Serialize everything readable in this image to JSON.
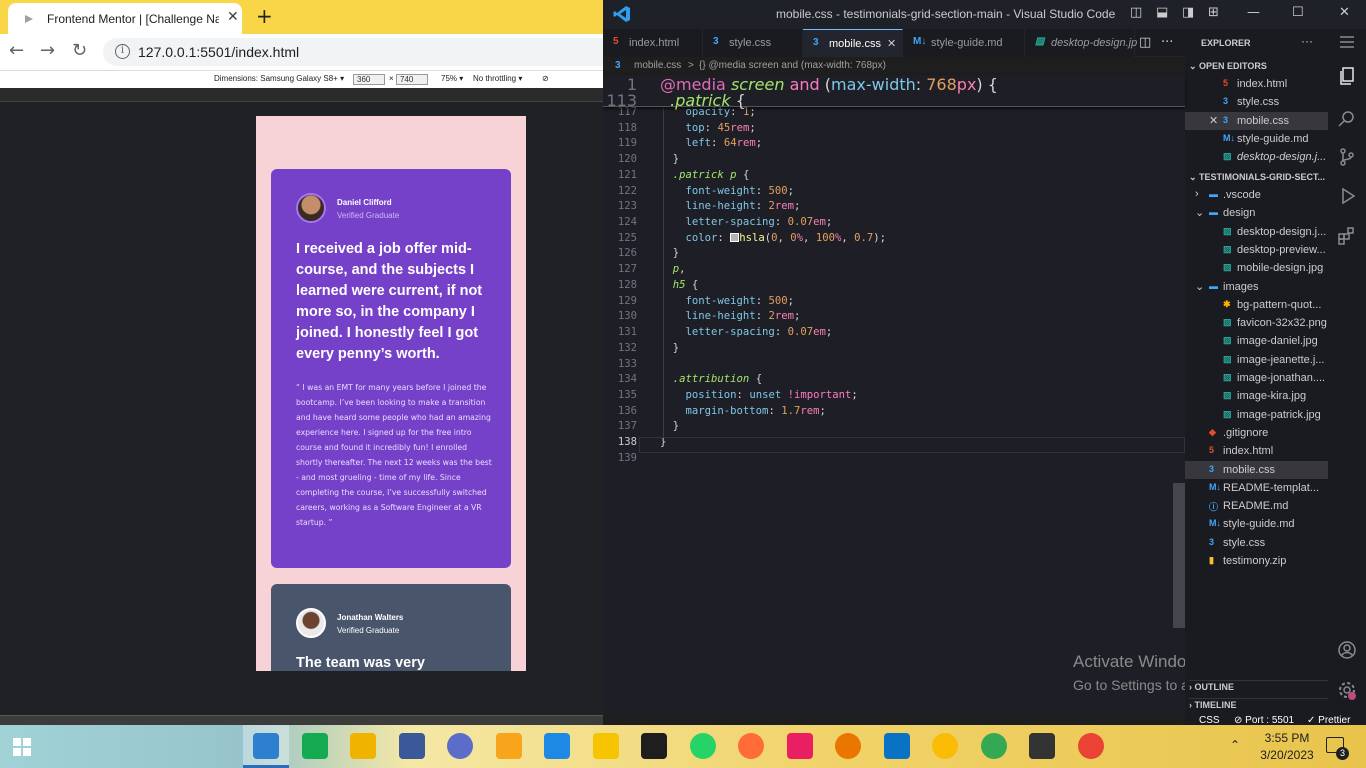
{
  "browser": {
    "tab_title": "Frontend Mentor | [Challenge Na",
    "url": "127.0.0.1:5501/index.html",
    "devtools": {
      "dimensions_label": "Dimensions: Samsung Galaxy S8+",
      "width": "360",
      "height": "740",
      "zoom": "75%",
      "throttling": "No throttling"
    }
  },
  "mobile_page": {
    "card1": {
      "name": "Daniel Clifford",
      "role": "Verified Graduate",
      "quote": "I received a job offer mid-course, and the subjects I learned were current, if not more so, in the company I joined. I honestly feel I got every penny’s worth.",
      "body": "“ I was an EMT for many years before I joined the bootcamp. I’ve been looking to make a transition and have heard some people who had an amazing experience here. I signed up for the free intro course and found it incredibly fun! I enrolled shortly thereafter. The next 12 weeks was the best - and most grueling - time of my life. Since completing the course, I’ve successfully switched careers, working as a Software Engineer at a VR startup. ”"
    },
    "card2": {
      "name": "Jonathan Walters",
      "role": "Verified Graduate",
      "quote": "The team was very"
    }
  },
  "vscode": {
    "title": "mobile.css - testimonials-grid-section-main - Visual Studio Code",
    "tabs": [
      {
        "label": "index.html",
        "icon": "html-icon"
      },
      {
        "label": "style.css",
        "icon": "css-icon"
      },
      {
        "label": "mobile.css",
        "icon": "css-icon",
        "active": true
      },
      {
        "label": "style-guide.md",
        "icon": "markdown-icon"
      },
      {
        "label": "desktop-design.jp",
        "icon": "image-icon"
      }
    ],
    "breadcrumb": {
      "file": "mobile.css",
      "sep": ">",
      "symbol": "{} @media screen and (max-width: 768px)"
    },
    "sticky_lines": [
      {
        "n": "1",
        "html": "<span class='at'>@media</span> <span class='sel'>screen</span> <span class='kw'>and</span> <span class='pun'>(</span><span class='prop'>max-width</span><span class='pun'>:</span> <span class='num'>768</span><span class='unit'>px</span><span class='pun'>) {</span>"
      },
      {
        "n": "113",
        "html": "  <span class='sel'>.patrick</span> <span class='pun'>{</span>"
      }
    ],
    "code_lines": [
      {
        "n": "117",
        "html": "    <span class='prop'>opacity</span><span class='pun'>:</span> <span class='num'>1</span><span class='pun'>;</span>"
      },
      {
        "n": "118",
        "html": "    <span class='prop'>top</span><span class='pun'>:</span> <span class='num'>45</span><span class='unit'>rem</span><span class='pun'>;</span>"
      },
      {
        "n": "119",
        "html": "    <span class='prop'>left</span><span class='pun'>:</span> <span class='num'>64</span><span class='unit'>rem</span><span class='pun'>;</span>"
      },
      {
        "n": "120",
        "html": "  <span class='pun'>}</span>"
      },
      {
        "n": "121",
        "html": "  <span class='sel'>.patrick p</span> <span class='pun'>{</span>"
      },
      {
        "n": "122",
        "html": "    <span class='prop'>font-weight</span><span class='pun'>:</span> <span class='num'>500</span><span class='pun'>;</span>"
      },
      {
        "n": "123",
        "html": "    <span class='prop'>line-height</span><span class='pun'>:</span> <span class='num'>2</span><span class='unit'>rem</span><span class='pun'>;</span>"
      },
      {
        "n": "124",
        "html": "    <span class='prop'>letter-spacing</span><span class='pun'>:</span> <span class='num'>0.07</span><span class='unit'>em</span><span class='pun'>;</span>"
      },
      {
        "n": "125",
        "html": "    <span class='prop'>color</span><span class='pun'>:</span> <span style='display:inline-block;width:9px;height:9px;background:#b3b3b3;border:1px solid #fff;vertical-align:-1px'></span><span class='fn'>hsla</span><span class='pun'>(</span><span class='num'>0</span><span class='pun'>,</span> <span class='num'>0</span><span class='unit'>%</span><span class='pun'>,</span> <span class='num'>100</span><span class='unit'>%</span><span class='pun'>,</span> <span class='num'>0.7</span><span class='pun'>);</span>"
      },
      {
        "n": "126",
        "html": "  <span class='pun'>}</span>"
      },
      {
        "n": "127",
        "html": "  <span class='sel'>p</span><span class='pun'>,</span>"
      },
      {
        "n": "128",
        "html": "  <span class='sel'>h5</span> <span class='pun'>{</span>"
      },
      {
        "n": "129",
        "html": "    <span class='prop'>font-weight</span><span class='pun'>:</span> <span class='num'>500</span><span class='pun'>;</span>"
      },
      {
        "n": "130",
        "html": "    <span class='prop'>line-height</span><span class='pun'>:</span> <span class='num'>2</span><span class='unit'>rem</span><span class='pun'>;</span>"
      },
      {
        "n": "131",
        "html": "    <span class='prop'>letter-spacing</span><span class='pun'>:</span> <span class='num'>0.07</span><span class='unit'>em</span><span class='pun'>;</span>"
      },
      {
        "n": "132",
        "html": "  <span class='pun'>}</span>"
      },
      {
        "n": "133",
        "html": ""
      },
      {
        "n": "134",
        "html": "  <span class='sel'>.attribution</span> <span class='pun'>{</span>"
      },
      {
        "n": "135",
        "html": "    <span class='prop'>position</span><span class='pun'>:</span> <span class='prop'>unset</span> <span class='kw'>!important</span><span class='pun'>;</span>"
      },
      {
        "n": "136",
        "html": "    <span class='prop'>margin-bottom</span><span class='pun'>:</span> <span class='num'>1.7</span><span class='unit'>rem</span><span class='pun'>;</span>"
      },
      {
        "n": "137",
        "html": "  <span class='pun'>}</span>"
      },
      {
        "n": "138",
        "html": "<span class='pun'>}</span>"
      },
      {
        "n": "139",
        "html": ""
      }
    ],
    "explorer": {
      "header": "EXPLORER",
      "open_editors_title": "OPEN EDITORS",
      "open_editors": [
        {
          "label": "index.html",
          "icon": "html-icon",
          "color": "#e44d26"
        },
        {
          "label": "style.css",
          "icon": "css-icon",
          "color": "#42a5f5"
        },
        {
          "label": "mobile.css",
          "icon": "css-icon",
          "color": "#42a5f5",
          "selected": true
        },
        {
          "label": "style-guide.md",
          "icon": "markdown-icon",
          "color": "#42a5f5"
        },
        {
          "label": "desktop-design.j...",
          "icon": "image-icon",
          "color": "#26a69a",
          "italic": true
        }
      ],
      "project_title": "TESTIMONIALS-GRID-SECT...",
      "tree": [
        {
          "label": ".vscode",
          "icon": "folder-icon",
          "color": "#42a5f5",
          "depth": 1,
          "arrow": "›"
        },
        {
          "label": "design",
          "icon": "folder-icon",
          "color": "#42a5f5",
          "depth": 1,
          "arrow": "⌄"
        },
        {
          "label": "desktop-design.j...",
          "icon": "image-icon",
          "color": "#26a69a",
          "depth": 2
        },
        {
          "label": "desktop-preview...",
          "icon": "image-icon",
          "color": "#26a69a",
          "depth": 2
        },
        {
          "label": "mobile-design.jpg",
          "icon": "image-icon",
          "color": "#26a69a",
          "depth": 2
        },
        {
          "label": "images",
          "icon": "folder-icon",
          "color": "#42a5f5",
          "depth": 1,
          "arrow": "⌄"
        },
        {
          "label": "bg-pattern-quot...",
          "icon": "svg-icon",
          "color": "#ffb300",
          "depth": 2
        },
        {
          "label": "favicon-32x32.png",
          "icon": "image-icon",
          "color": "#26a69a",
          "depth": 2
        },
        {
          "label": "image-daniel.jpg",
          "icon": "image-icon",
          "color": "#26a69a",
          "depth": 2
        },
        {
          "label": "image-jeanette.j...",
          "icon": "image-icon",
          "color": "#26a69a",
          "depth": 2
        },
        {
          "label": "image-jonathan....",
          "icon": "image-icon",
          "color": "#26a69a",
          "depth": 2
        },
        {
          "label": "image-kira.jpg",
          "icon": "image-icon",
          "color": "#26a69a",
          "depth": 2
        },
        {
          "label": "image-patrick.jpg",
          "icon": "image-icon",
          "color": "#26a69a",
          "depth": 2
        },
        {
          "label": ".gitignore",
          "icon": "git-icon",
          "color": "#e44d26",
          "depth": 1
        },
        {
          "label": "index.html",
          "icon": "html-icon",
          "color": "#e44d26",
          "depth": 1
        },
        {
          "label": "mobile.css",
          "icon": "css-icon",
          "color": "#42a5f5",
          "depth": 1,
          "selected": true
        },
        {
          "label": "README-templat...",
          "icon": "markdown-icon",
          "color": "#42a5f5",
          "depth": 1
        },
        {
          "label": "README.md",
          "icon": "info-icon",
          "color": "#42a5f5",
          "depth": 1
        },
        {
          "label": "style-guide.md",
          "icon": "markdown-icon",
          "color": "#42a5f5",
          "depth": 1
        },
        {
          "label": "style.css",
          "icon": "css-icon",
          "color": "#42a5f5",
          "depth": 1
        },
        {
          "label": "testimony.zip",
          "icon": "zip-icon",
          "color": "#fbc02d",
          "depth": 1
        }
      ],
      "outline_title": "OUTLINE",
      "timeline_title": "TIMELINE"
    },
    "status": {
      "language": "CSS",
      "port": "Port : 5501",
      "prettier": "Prettier"
    },
    "watermark": {
      "line1": "Activate Windows",
      "line2": "Go to Settings to activate Windows."
    }
  },
  "taskbar": {
    "time": "3:55 PM",
    "date": "3/20/2023",
    "notifications": "3",
    "apps": [
      "vscode-icon",
      "mongodb-icon",
      "file-explorer-icon",
      "calendar-icon",
      "browser-icon",
      "lambda-icon",
      "affinity-icon",
      "sticky-notes-icon",
      "terminal-icon",
      "whatsapp-icon",
      "postman-icon",
      "app-icon",
      "blender-icon",
      "remote-desktop-icon",
      "chrome-icon",
      "chrome-dev-icon",
      "app-icon-2",
      "chrome-canary-icon"
    ]
  }
}
